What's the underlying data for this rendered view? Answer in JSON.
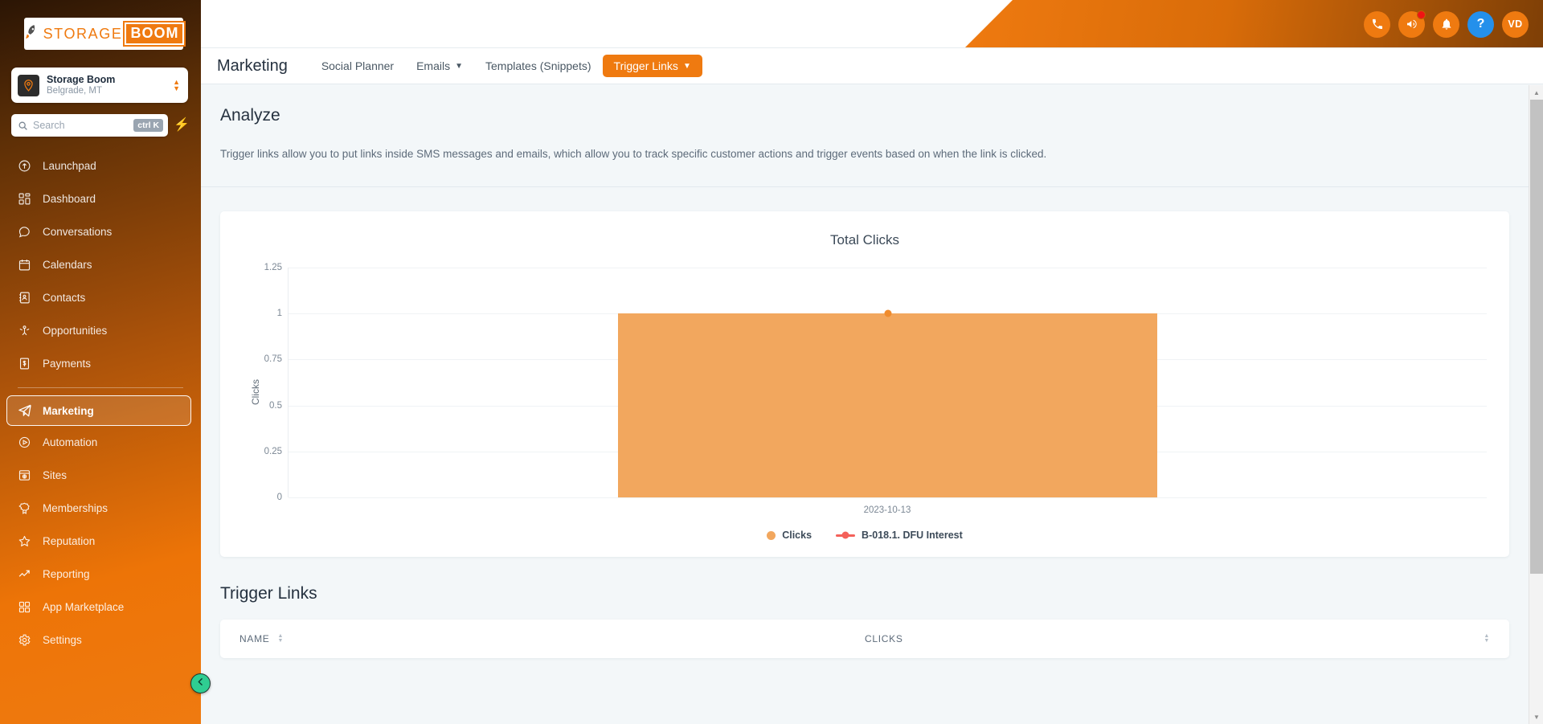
{
  "sidebar": {
    "logo": {
      "rocket_icon": "rocket-icon",
      "text_primary": "STORAGE",
      "text_secondary": "BOOM"
    },
    "location": {
      "name": "Storage Boom",
      "sublabel": "Belgrade, MT",
      "avatar_icon": "location-pin-icon",
      "chevron_icon": "chevron-updown-icon"
    },
    "search": {
      "placeholder": "Search",
      "shortcut": "ctrl K",
      "icon": "search-icon",
      "bolt_icon": "lightning-bolt-icon"
    },
    "items": [
      {
        "label": "Launchpad",
        "icon": "rocket-launch-icon",
        "active": false
      },
      {
        "label": "Dashboard",
        "icon": "grid-icon",
        "active": false
      },
      {
        "label": "Conversations",
        "icon": "chat-bubble-icon",
        "active": false
      },
      {
        "label": "Calendars",
        "icon": "calendar-icon",
        "active": false
      },
      {
        "label": "Contacts",
        "icon": "contact-card-icon",
        "active": false
      },
      {
        "label": "Opportunities",
        "icon": "opportunities-icon",
        "active": false
      },
      {
        "label": "Payments",
        "icon": "payments-icon",
        "active": false
      },
      {
        "label": "Marketing",
        "icon": "paper-plane-icon",
        "active": true
      },
      {
        "label": "Automation",
        "icon": "play-circle-icon",
        "active": false
      },
      {
        "label": "Sites",
        "icon": "sites-icon",
        "active": false
      },
      {
        "label": "Memberships",
        "icon": "badge-icon",
        "active": false
      },
      {
        "label": "Reputation",
        "icon": "star-icon",
        "active": false
      },
      {
        "label": "Reporting",
        "icon": "trend-up-icon",
        "active": false
      },
      {
        "label": "App Marketplace",
        "icon": "grid-icon",
        "active": false
      },
      {
        "label": "Settings",
        "icon": "gear-icon",
        "active": false
      }
    ],
    "collapse_icon": "chevron-left-icon"
  },
  "header": {
    "icons": [
      {
        "name": "phone-icon",
        "badge": false
      },
      {
        "name": "megaphone-icon",
        "badge": true
      },
      {
        "name": "bell-icon",
        "badge": false
      },
      {
        "name": "help-question-icon",
        "badge": false
      }
    ],
    "avatar_initials": "VD",
    "colors": {
      "accent": "#ef7a10",
      "help": "#2490eb",
      "badge": "#f01414"
    }
  },
  "nav": {
    "page_title": "Marketing",
    "tabs": [
      {
        "label": "Social Planner",
        "caret": false,
        "active": false
      },
      {
        "label": "Emails",
        "caret": true,
        "active": false
      },
      {
        "label": "Templates (Snippets)",
        "caret": false,
        "active": false
      },
      {
        "label": "Trigger Links",
        "caret": true,
        "active": true
      }
    ]
  },
  "analyze": {
    "title": "Analyze",
    "description": "Trigger links allow you to put links inside SMS messages and emails, which allow you to track specific customer actions and trigger events based on when the link is clicked."
  },
  "chart_data": {
    "type": "bar",
    "title": "Total Clicks",
    "categories": [
      "2023-10-13"
    ],
    "values": [
      1
    ],
    "xlabel": "",
    "ylabel": "Clicks",
    "ylim": [
      0,
      1.25
    ],
    "yticks": [
      "1.25",
      "1",
      "0.75",
      "0.5",
      "0.25",
      "0"
    ],
    "grid": true,
    "legend_position": "bottom",
    "series": [
      {
        "name": "Clicks",
        "values": [
          1
        ],
        "color": "#f2a75e",
        "marker": "circle"
      },
      {
        "name": "B-018.1. DFU Interest",
        "values": [
          1
        ],
        "color": "#f4615a",
        "marker": "line-dot"
      }
    ],
    "legend": [
      {
        "label": "Clicks",
        "style": "dot",
        "color": "#f2a75e"
      },
      {
        "label": "B-018.1. DFU Interest",
        "style": "line-dot",
        "color": "#f4615a"
      }
    ],
    "point_marker": {
      "x": "2023-10-13",
      "y": 1,
      "color": "#f08c2e"
    }
  },
  "table": {
    "section_title": "Trigger Links",
    "columns": [
      {
        "label": "NAME",
        "sortable": true
      },
      {
        "label": "CLICKS",
        "sortable": true
      }
    ],
    "rows": []
  },
  "scrollbar": {
    "up_icon": "scroll-up-arrow-icon",
    "down_icon": "scroll-down-arrow-icon"
  }
}
